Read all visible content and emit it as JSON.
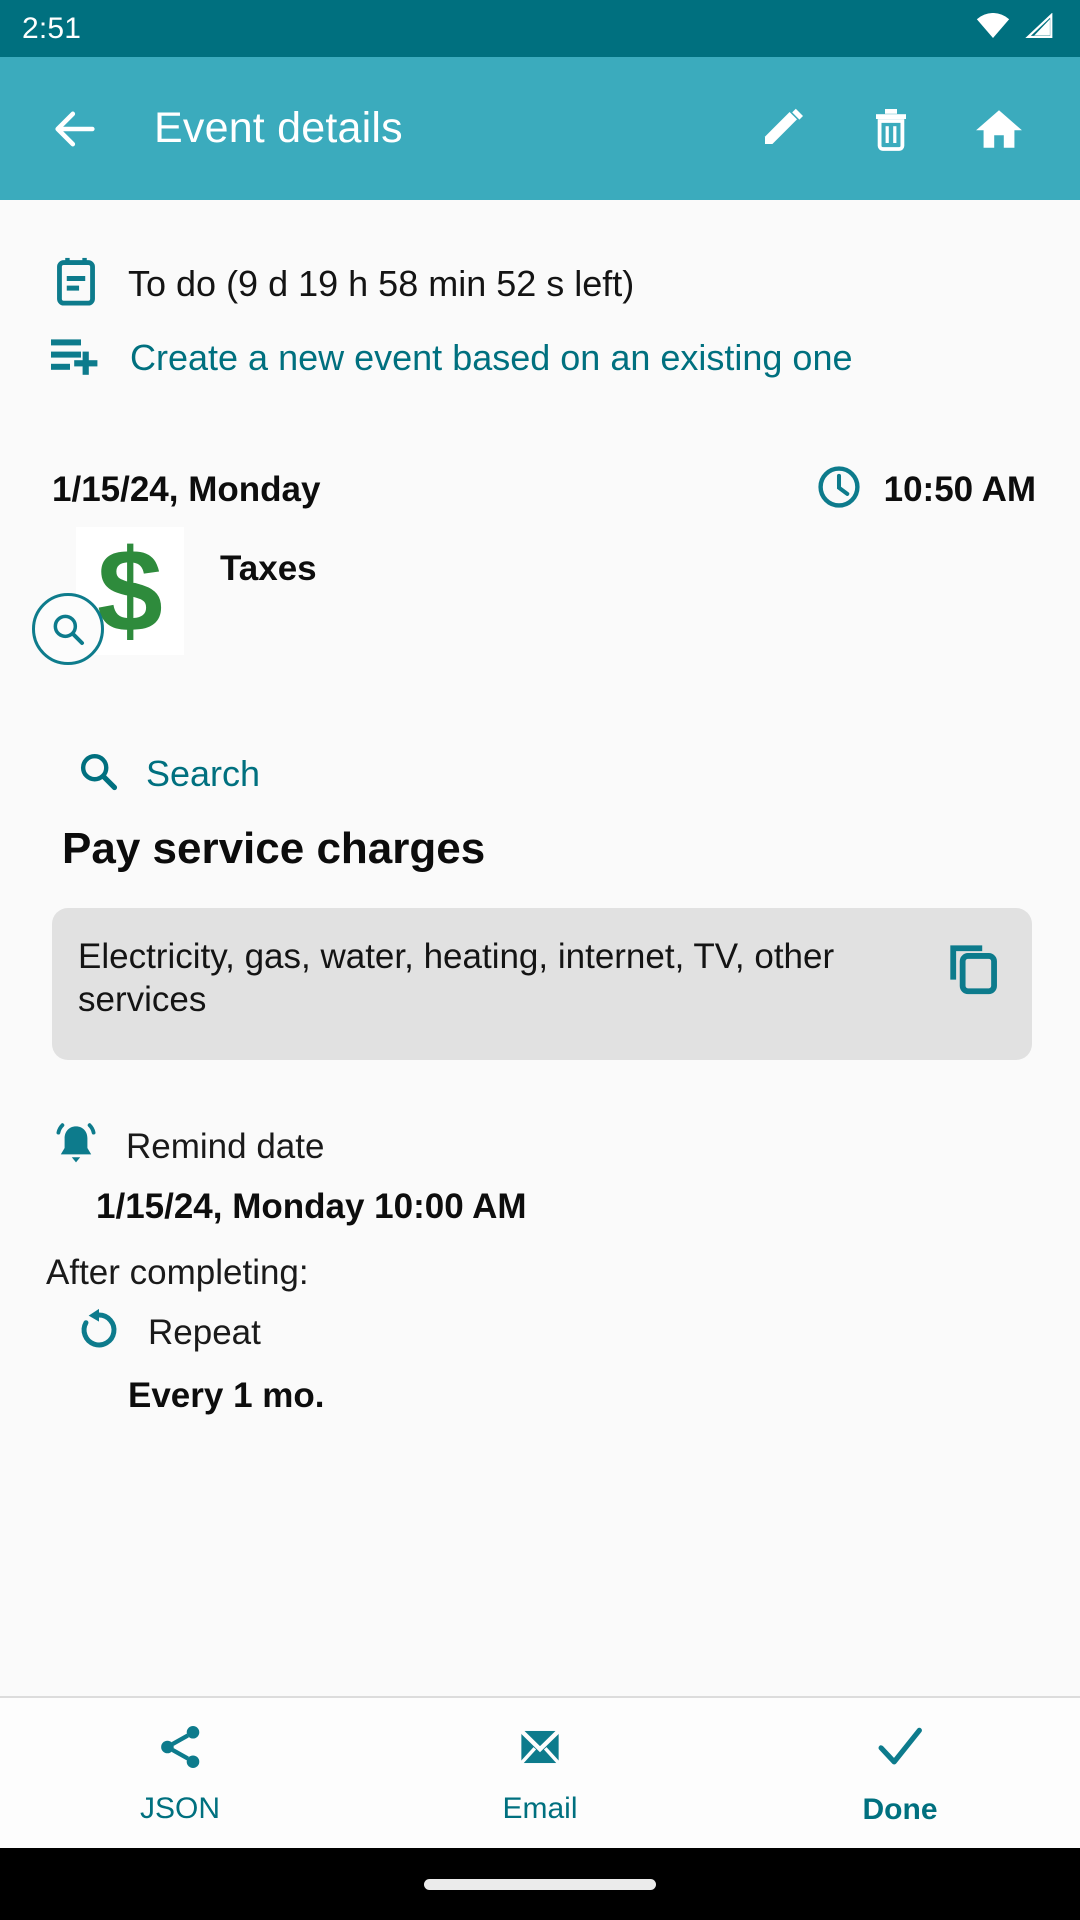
{
  "status_bar": {
    "clock": "2:51",
    "wifi_icon": "wifi-icon",
    "signal_icon": "cell-signal-icon",
    "background": "#00707f"
  },
  "app_bar": {
    "title": "Event details",
    "back_icon": "arrow-back-icon",
    "edit_label": "Edit",
    "delete_label": "Delete",
    "home_label": "Home",
    "background": "#3babbd"
  },
  "content": {
    "status": {
      "icon": "note-calendar-icon",
      "text": "To do (9 d 19 h 58 min 52 s left)"
    },
    "create_from_existing": {
      "icon": "playlist-add-icon",
      "text": "Create a new event based on an existing one",
      "color": "#00707f"
    },
    "schedule": {
      "date": "1/15/24, Monday",
      "time": "10:50 AM",
      "clock_icon": "clock-icon"
    },
    "category": {
      "image_glyph": "$",
      "image_color": "#2e8b3c",
      "label": "Taxes",
      "badge_icon": "search-badge-icon"
    },
    "search": {
      "icon": "search-icon",
      "label": "Search",
      "color": "#00707f"
    },
    "event_title": "Pay service charges",
    "description": {
      "text": "Electricity, gas, water, heating, internet, TV, other services",
      "copy_icon": "copy-icon",
      "background": "#e1e1e1"
    },
    "remind": {
      "icon": "bell-icon",
      "label": "Remind date",
      "value": "1/15/24, Monday 10:00 AM"
    },
    "after_completing": {
      "label": "After completing:",
      "repeat_icon": "repeat-rotate-icon",
      "repeat_label": "Repeat",
      "repeat_value": "Every 1 mo."
    }
  },
  "bottom_bar": {
    "items": [
      {
        "icon": "share-icon",
        "label": "JSON"
      },
      {
        "icon": "email-icon",
        "label": "Email"
      },
      {
        "icon": "check-icon",
        "label": "Done"
      }
    ],
    "accent": "#00707f"
  }
}
